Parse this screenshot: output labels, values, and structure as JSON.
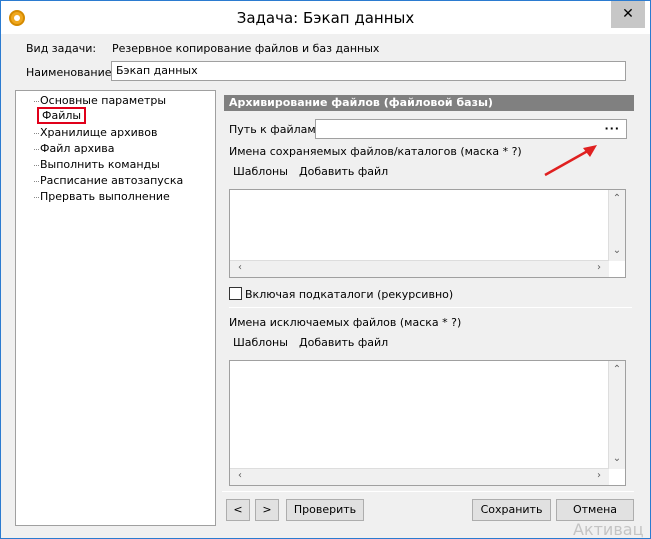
{
  "window": {
    "title": "Задача: Бэкап данных",
    "close_glyph": "✕"
  },
  "task": {
    "type_label": "Вид задачи:",
    "type_value": "Резервное копирование файлов и баз данных",
    "name_label": "Наименование:",
    "name_value": "Бэкап данных"
  },
  "sidebar": {
    "items": [
      {
        "label": "Основные параметры"
      },
      {
        "label": "Файлы",
        "selected": true
      },
      {
        "label": "Хранилище архивов"
      },
      {
        "label": "Файл архива"
      },
      {
        "label": "Выполнить команды"
      },
      {
        "label": "Расписание автозапуска"
      },
      {
        "label": "Прервать выполнение"
      }
    ]
  },
  "files": {
    "section_title": "Архивирование файлов (файловой базы)",
    "path_label": "Путь к файлам:",
    "path_value": "",
    "path_button": "···",
    "saved_label": "Имена сохраняемых файлов/каталогов (маска * ?)",
    "saved_toolbar": {
      "templates": "Шаблоны",
      "add_file": "Добавить файл"
    },
    "recursive_label": "Включая подкаталоги (рекурсивно)",
    "recursive_checked": false,
    "excluded_label": "Имена исключаемых файлов (маска * ?)",
    "excluded_toolbar": {
      "templates": "Шаблоны",
      "add_file": "Добавить файл"
    }
  },
  "footer": {
    "prev": "<",
    "next": ">",
    "check": "Проверить",
    "save": "Сохранить",
    "cancel": "Отмена"
  },
  "watermark": "Активац",
  "colors": {
    "accent_border": "#2b7bd0",
    "selection": "#e0001a",
    "annotation_arrow": "#e02020"
  }
}
